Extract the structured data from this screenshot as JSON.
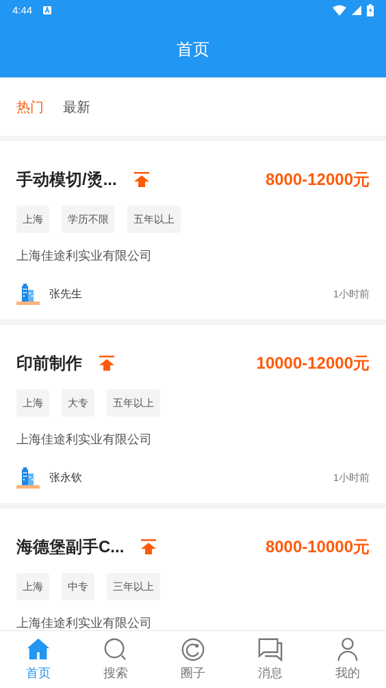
{
  "status_bar": {
    "time": "4:44"
  },
  "header": {
    "title": "首页"
  },
  "tabs": [
    {
      "label": "热门",
      "selected": true
    },
    {
      "label": "最新",
      "selected": false
    }
  ],
  "jobs": [
    {
      "title": "手动模切/烫...",
      "pinned": true,
      "salary": "8000-12000元",
      "tags": [
        "上海",
        "学历不限",
        "五年以上"
      ],
      "company": "上海佳途利实业有限公司",
      "contact": "张先生",
      "time": "1小时前"
    },
    {
      "title": "印前制作",
      "pinned": true,
      "salary": "10000-12000元",
      "tags": [
        "上海",
        "大专",
        "五年以上"
      ],
      "company": "上海佳途利实业有限公司",
      "contact": "张永钦",
      "time": "1小时前"
    },
    {
      "title": "海德堡副手C...",
      "pinned": true,
      "salary": "8000-10000元",
      "tags": [
        "上海",
        "中专",
        "三年以上"
      ],
      "company": "上海佳途利实业有限公司"
    }
  ],
  "nav": [
    {
      "label": "首页",
      "kind": "home",
      "selected": true
    },
    {
      "label": "搜索",
      "kind": "search",
      "selected": false
    },
    {
      "label": "圈子",
      "kind": "circle",
      "selected": false
    },
    {
      "label": "消息",
      "kind": "message",
      "selected": false
    },
    {
      "label": "我的",
      "kind": "profile",
      "selected": false
    }
  ]
}
